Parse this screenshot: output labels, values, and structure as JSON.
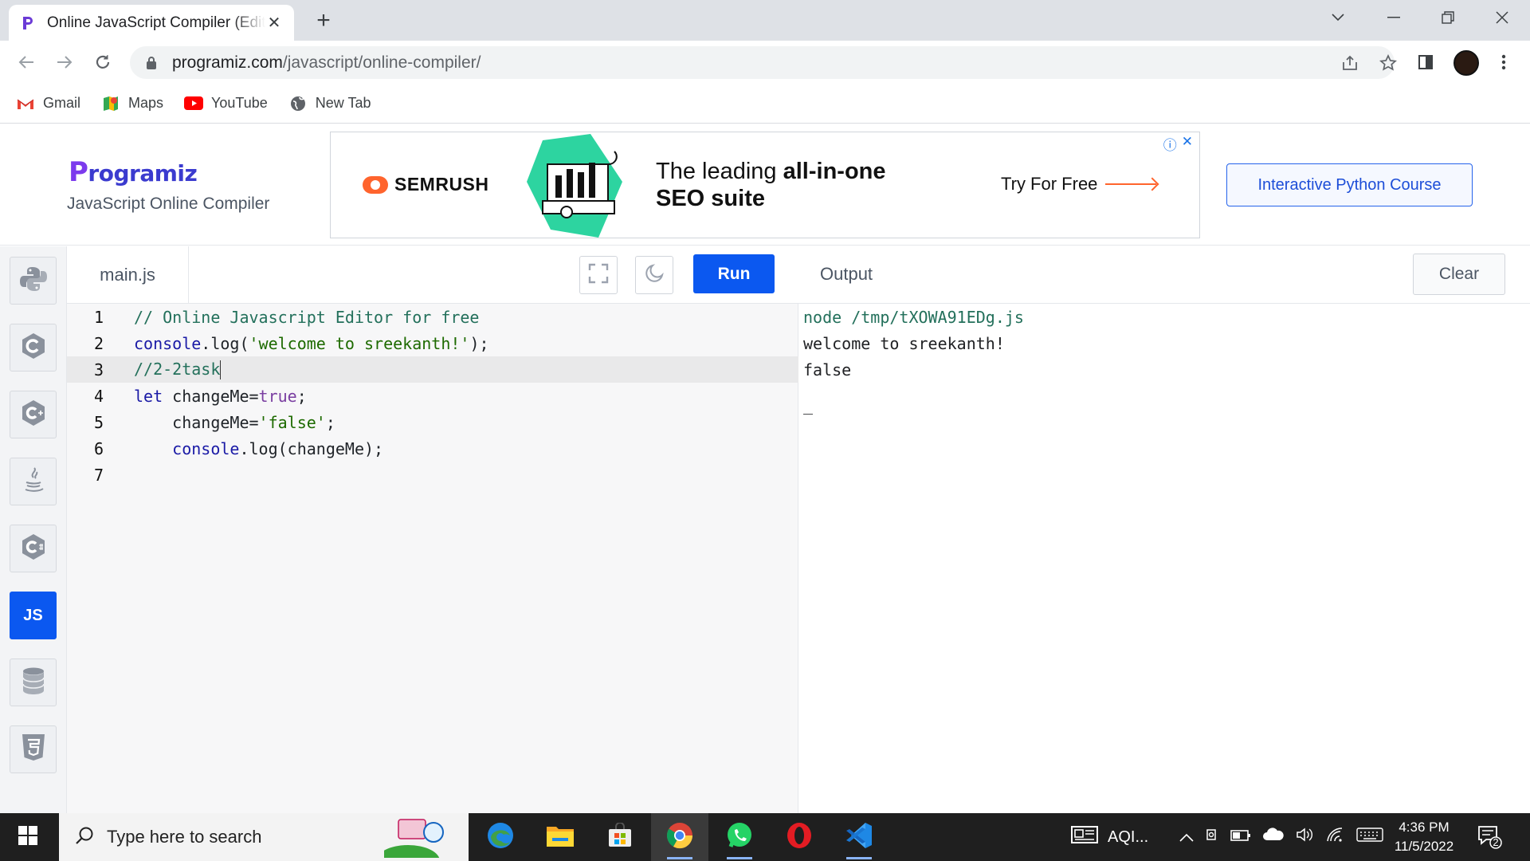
{
  "browser": {
    "tab_title": "Online JavaScript Compiler (Editor)",
    "url_host": "programiz.com",
    "url_path": "/javascript/online-compiler/",
    "bookmarks": [
      {
        "label": "Gmail"
      },
      {
        "label": "Maps"
      },
      {
        "label": "YouTube"
      },
      {
        "label": "New Tab"
      }
    ]
  },
  "site": {
    "logo_rest": "rogramiz",
    "subtitle": "JavaScript Online Compiler",
    "course_button": "Interactive Python Course"
  },
  "ad": {
    "brand": "SEMRUSH",
    "tagline_plain": "The leading ",
    "tagline_bold1": "all-in-one",
    "tagline_bold2": "SEO suite",
    "cta": "Try For Free"
  },
  "sidebar": {
    "languages": [
      {
        "name": "python",
        "icon": "python-icon"
      },
      {
        "name": "c",
        "icon": "c-icon"
      },
      {
        "name": "cpp",
        "icon": "cpp-icon"
      },
      {
        "name": "java",
        "icon": "java-icon"
      },
      {
        "name": "csharp",
        "icon": "csharp-icon"
      },
      {
        "name": "javascript",
        "label": "JS",
        "active": true
      },
      {
        "name": "sql",
        "icon": "database-icon"
      },
      {
        "name": "html",
        "icon": "html5-icon"
      }
    ]
  },
  "editor": {
    "filename": "main.js",
    "run_label": "Run",
    "current_line": 3,
    "lines": [
      {
        "n": "1",
        "text": "// Online Javascript Editor for free"
      },
      {
        "n": "2",
        "text": "console.log('welcome to sreekanth!');"
      },
      {
        "n": "3",
        "text": "//2-2task"
      },
      {
        "n": "4",
        "text": "let changeMe=true;"
      },
      {
        "n": "5",
        "text": "    changeMe='false';"
      },
      {
        "n": "6",
        "text": "    console.log(changeMe);"
      },
      {
        "n": "7",
        "text": ""
      }
    ]
  },
  "output": {
    "title": "Output",
    "clear_label": "Clear",
    "lines": [
      "node /tmp/tXOWA91EDg.js",
      "welcome to sreekanth!",
      "false",
      "_"
    ]
  },
  "taskbar": {
    "search_placeholder": "Type here to search",
    "weather_label": "AQI...",
    "time": "4:36 PM",
    "date": "11/5/2022",
    "notification_count": "2"
  },
  "colors": {
    "accent": "#0b58f0",
    "taskbar": "#1f1f1f",
    "semrush": "#ff642d"
  }
}
